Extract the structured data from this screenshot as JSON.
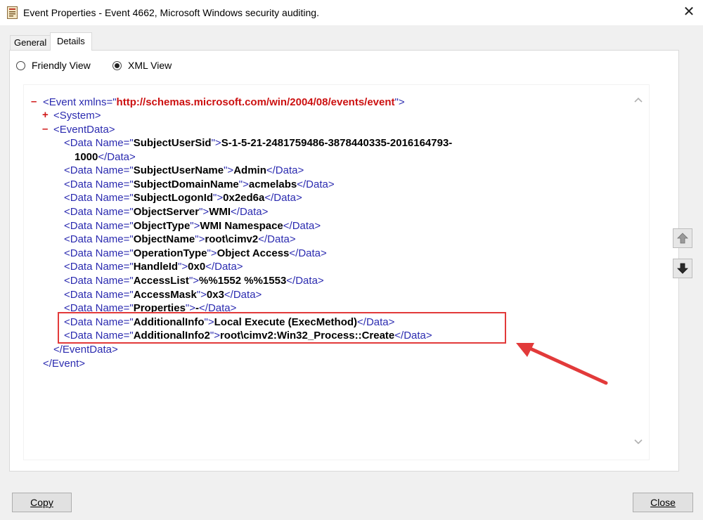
{
  "window": {
    "title": "Event Properties - Event 4662, Microsoft Windows security auditing.",
    "close_glyph": "✕"
  },
  "tabs": {
    "general": "General",
    "details": "Details",
    "active": "Details"
  },
  "view_options": {
    "friendly_label": "Friendly View",
    "xml_label": "XML View",
    "selected": "XML View"
  },
  "xml": {
    "event_open": "<Event xmlns=\"",
    "namespace": "http://schemas.microsoft.com/win/2004/08/events/event",
    "event_open_end": "\">",
    "system_tag": "<System>",
    "eventdata_open": "<EventData>",
    "eventdata_close": "</EventData>",
    "event_close": "</Event>",
    "data_rows": [
      {
        "name": "SubjectUserSid",
        "value": "S-1-5-21-2481759486-3878440335-2016164793-",
        "value_cont": "1000"
      },
      {
        "name": "SubjectUserName",
        "value": "Admin"
      },
      {
        "name": "SubjectDomainName",
        "value": "acmelabs"
      },
      {
        "name": "SubjectLogonId",
        "value": "0x2ed6a"
      },
      {
        "name": "ObjectServer",
        "value": "WMI"
      },
      {
        "name": "ObjectType",
        "value": "WMI Namespace"
      },
      {
        "name": "ObjectName",
        "value": "root\\cimv2"
      },
      {
        "name": "OperationType",
        "value": "Object Access"
      },
      {
        "name": "HandleId",
        "value": "0x0"
      },
      {
        "name": "AccessList",
        "value": "%%1552 %%1553"
      },
      {
        "name": "AccessMask",
        "value": "0x3"
      },
      {
        "name": "Properties",
        "value": "-"
      },
      {
        "name": "AdditionalInfo",
        "value": "Local Execute (ExecMethod)"
      },
      {
        "name": "AdditionalInfo2",
        "value": "root\\cimv2:Win32_Process::Create"
      }
    ]
  },
  "buttons": {
    "copy": "Copy",
    "close": "Close"
  },
  "colors": {
    "accent_red": "#e23a3a",
    "xml_blue": "#2b2bb0",
    "xml_red": "#e01b24"
  },
  "icons": [
    "app-icon",
    "close-icon",
    "scroll-up-icon",
    "scroll-down-icon",
    "previous-event-icon",
    "next-event-icon",
    "arrow-annotation"
  ]
}
